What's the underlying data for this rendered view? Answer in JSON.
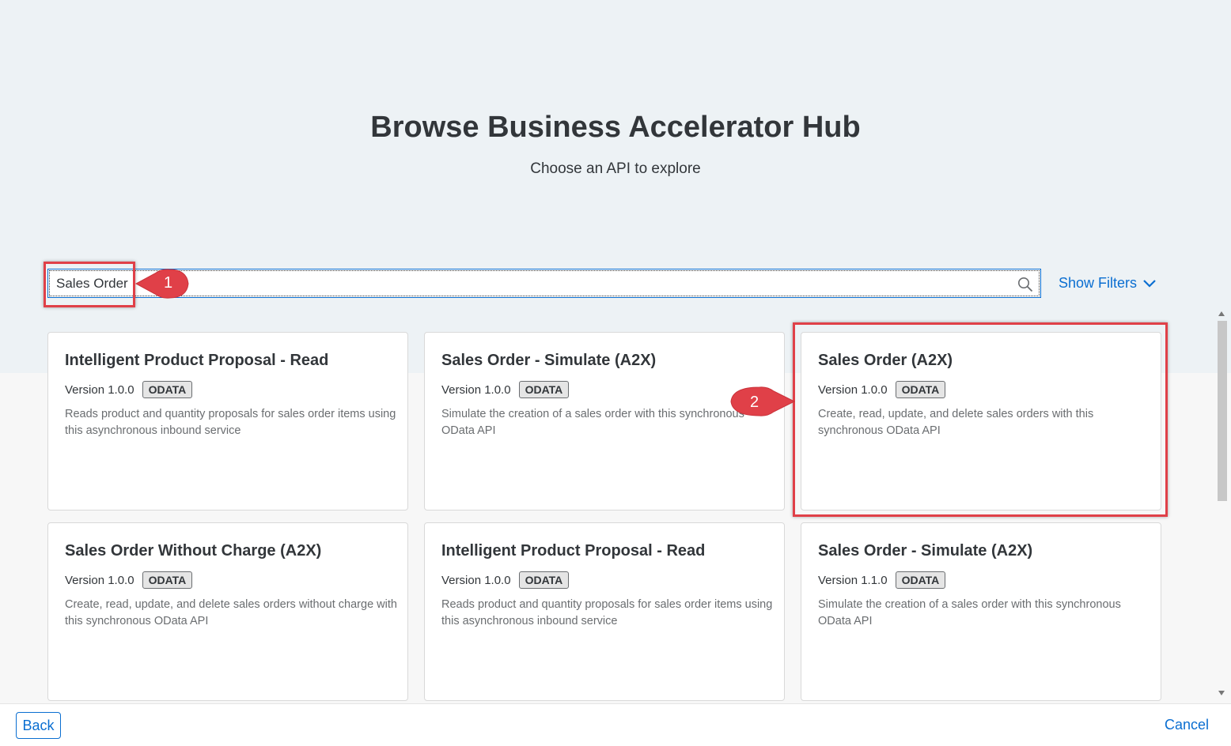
{
  "header": {
    "title": "Browse Business Accelerator Hub",
    "subtitle": "Choose an API to explore"
  },
  "search": {
    "value": "Sales Order",
    "icon": "search-icon"
  },
  "filters": {
    "label": "Show Filters",
    "icon": "chevron-down-icon"
  },
  "cards": [
    {
      "title": "Intelligent Product Proposal - Read",
      "version": "Version 1.0.0",
      "type": "ODATA",
      "description": "Reads product and quantity proposals for sales order items using this asynchronous inbound service"
    },
    {
      "title": "Sales Order - Simulate (A2X)",
      "version": "Version 1.0.0",
      "type": "ODATA",
      "description": "Simulate the creation of a sales order with this synchronous OData API"
    },
    {
      "title": "Sales Order (A2X)",
      "version": "Version 1.0.0",
      "type": "ODATA",
      "description": "Create, read, update, and delete sales orders with this synchronous OData API"
    },
    {
      "title": "Sales Order Without Charge (A2X)",
      "version": "Version 1.0.0",
      "type": "ODATA",
      "description": "Create, read, update, and delete sales orders without charge with this synchronous OData API"
    },
    {
      "title": "Intelligent Product Proposal - Read",
      "version": "Version 1.0.0",
      "type": "ODATA",
      "description": "Reads product and quantity proposals for sales order items using this asynchronous inbound service"
    },
    {
      "title": "Sales Order - Simulate (A2X)",
      "version": "Version 1.1.0",
      "type": "ODATA",
      "description": "Simulate the creation of a sales order with this synchronous OData API"
    }
  ],
  "footer": {
    "back": "Back",
    "cancel": "Cancel"
  },
  "annotations": {
    "step1": "1",
    "step2": "2",
    "color": "#e04048"
  },
  "colors": {
    "accent": "#0a6ed1",
    "hero_background": "#edf2f5"
  }
}
